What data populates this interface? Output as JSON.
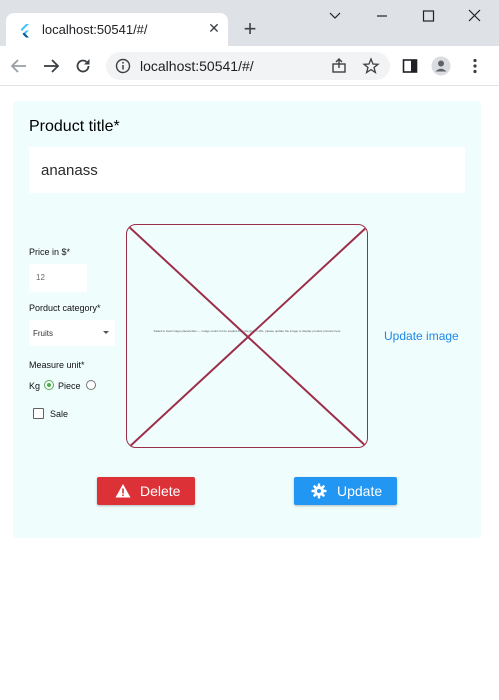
{
  "browser": {
    "tab_title": "localhost:50541/#/",
    "tab_close": "✕",
    "new_tab": "+",
    "url": "localhost:50541/#/"
  },
  "form": {
    "product_title_label": "Product title*",
    "product_title_value": "ananass",
    "price_label": "Price in $*",
    "price_value": "12",
    "category_label": "Porduct category*",
    "category_value": "Fruits",
    "measure_label": "Measure unit*",
    "measure_options": [
      "Kg",
      "Piece"
    ],
    "measure_selected": "Kg",
    "sale_label": "Sale",
    "sale_checked": false,
    "update_image_label": "Update image",
    "image_caption": "Failed to load image placeholder — image could not be loaded from the given URL, please update the image to display product preview here"
  },
  "actions": {
    "delete_label": "Delete",
    "update_label": "Update"
  },
  "colors": {
    "card_background": "#f0fdfd",
    "delete_button": "#dc3137",
    "update_button": "#2196f3",
    "link": "#1e88e5",
    "image_border": "#9c2e4a",
    "radio_selected": "#4caf50"
  }
}
